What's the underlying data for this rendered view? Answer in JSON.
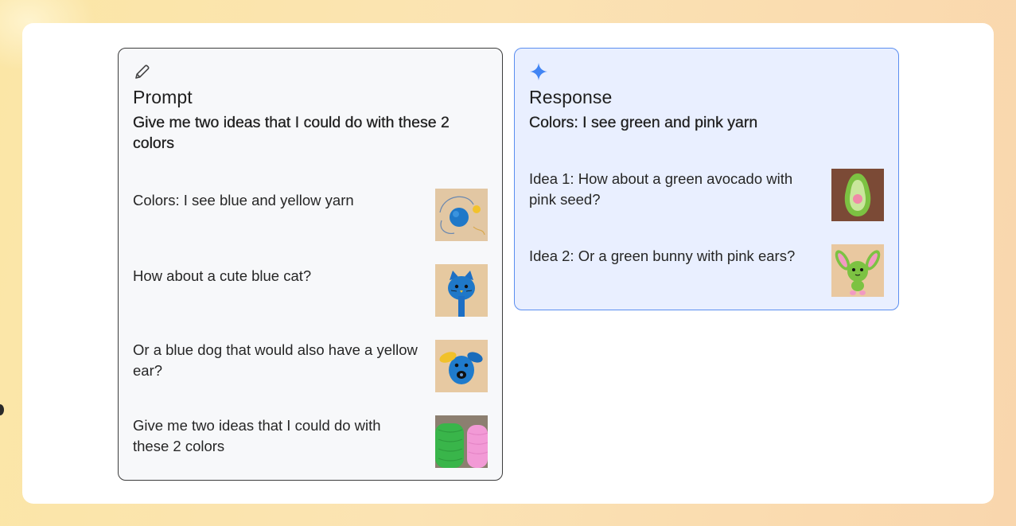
{
  "prompt": {
    "icon": "pencil-icon",
    "title": "Prompt",
    "subtitle": "Give me two ideas that I could do with these 2 colors",
    "items": [
      {
        "text": "Colors: I see blue and yellow yarn",
        "image": "blue-yarn-ball-with-yellow-pompom"
      },
      {
        "text": "How about a cute blue cat?",
        "image": "blue-crochet-cat"
      },
      {
        "text": "Or a blue dog that would also have a yellow ear?",
        "image": "blue-crochet-dog-yellow-ear"
      },
      {
        "text": "Give me two ideas that I could do with these 2 colors",
        "image": "green-and-pink-yarn-skeins"
      }
    ]
  },
  "response": {
    "icon": "sparkle-icon",
    "title": "Response",
    "subtitle": "Colors: I see green and pink yarn",
    "items": [
      {
        "text": "Idea 1: How about a green avocado with pink seed?",
        "image": "green-crochet-avocado-pink-seed"
      },
      {
        "text": "Idea 2: Or a green bunny with pink ears?",
        "image": "green-crochet-bunny-pink-ears"
      }
    ]
  },
  "colors": {
    "prompt_border": "#3c3c3c",
    "response_border": "#5b8ef0",
    "response_bg": "#e9efff",
    "sparkle": "#4285f4"
  }
}
